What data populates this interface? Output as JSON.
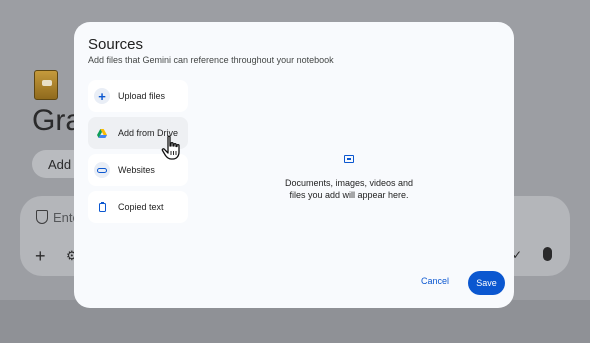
{
  "background": {
    "notebook_title_partial": "Gra",
    "add_pill_partial": "Add s",
    "input_placeholder_partial": "Ente"
  },
  "dialog": {
    "title": "Sources",
    "subtitle": "Add files that Gemini can reference throughout your notebook",
    "sources": [
      {
        "label": "Upload files",
        "icon": "plus-icon"
      },
      {
        "label": "Add from Drive",
        "icon": "google-drive-icon"
      },
      {
        "label": "Websites",
        "icon": "link-icon"
      },
      {
        "label": "Copied text",
        "icon": "clipboard-icon"
      }
    ],
    "empty_state_line1": "Documents, images, videos and",
    "empty_state_line2": "files you add will appear here.",
    "cancel_label": "Cancel",
    "save_label": "Save"
  },
  "colors": {
    "accent": "#0b57d0",
    "dialog_bg": "#f8fafd",
    "scrim": "#9c9ea3"
  }
}
